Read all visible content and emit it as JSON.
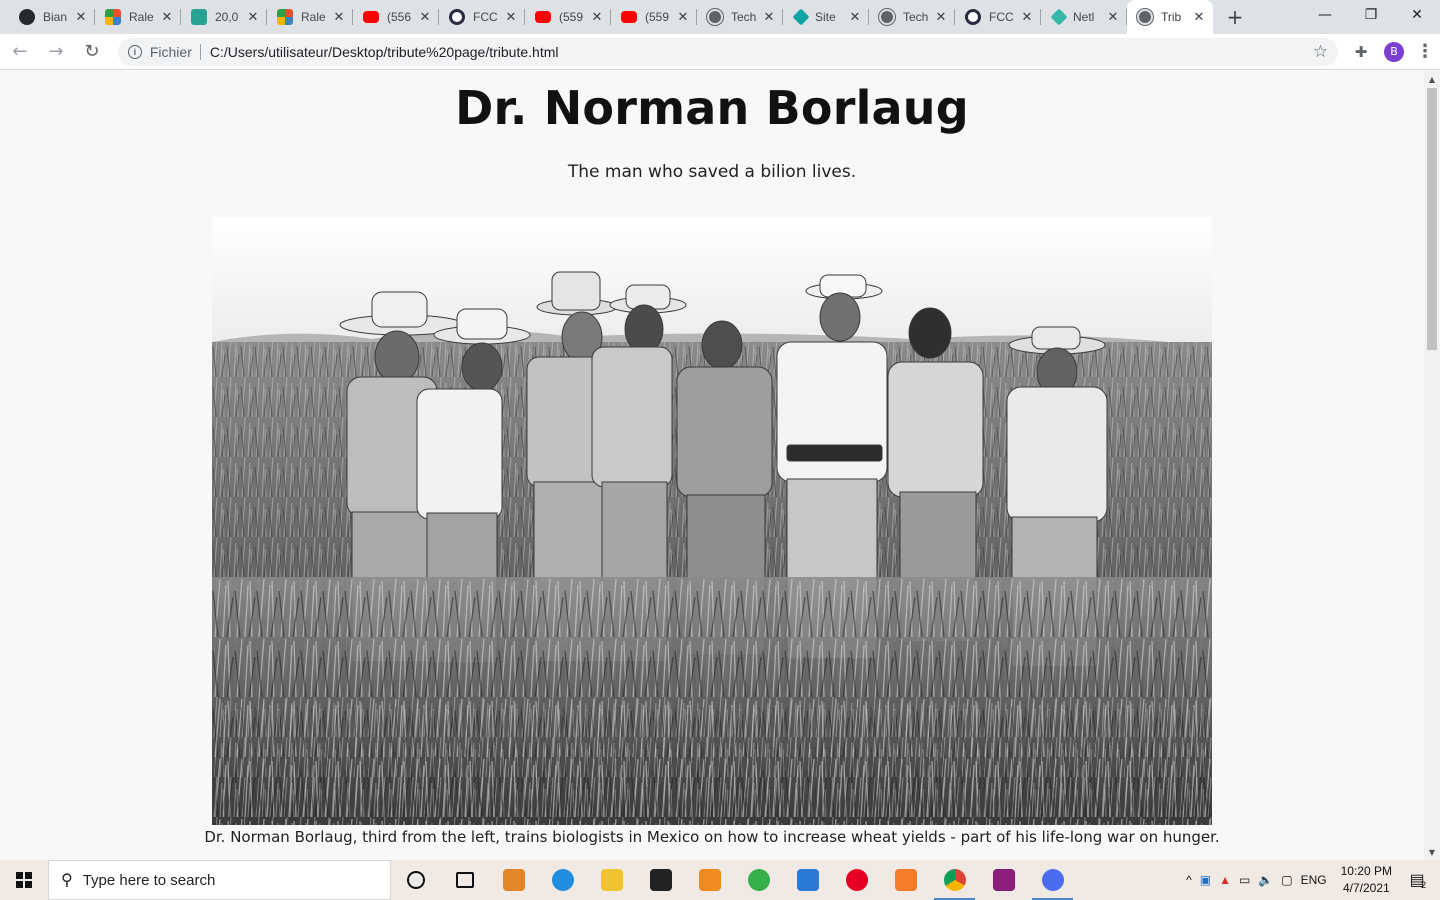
{
  "browser": {
    "tabs": [
      {
        "title": "Bian",
        "icon": "github-icon"
      },
      {
        "title": "Rale",
        "icon": "rale-icon"
      },
      {
        "title": "20,0",
        "icon": "dev-icon"
      },
      {
        "title": "Rale",
        "icon": "rale-icon"
      },
      {
        "title": "(556",
        "icon": "youtube-icon"
      },
      {
        "title": "FCC",
        "icon": "fcc-icon"
      },
      {
        "title": "(559",
        "icon": "youtube-icon"
      },
      {
        "title": "(559",
        "icon": "youtube-icon"
      },
      {
        "title": "Tech",
        "icon": "globe-icon"
      },
      {
        "title": "Site",
        "icon": "site-icon"
      },
      {
        "title": "Tech",
        "icon": "globe-icon"
      },
      {
        "title": "FCC",
        "icon": "fcc-icon"
      },
      {
        "title": "Netl",
        "icon": "netlify-icon"
      },
      {
        "title": "Trib",
        "icon": "globe-icon",
        "active": true
      }
    ],
    "close_glyph": "✕",
    "new_tab_glyph": "+",
    "window_controls": {
      "minimize": "—",
      "restore": "❐",
      "close": "✕"
    },
    "toolbar": {
      "back": "←",
      "forward": "→",
      "reload": "↻",
      "info_glyph": "i",
      "scheme_label": "Fichier",
      "url": "C:/Users/utilisateur/Desktop/tribute%20page/tribute.html",
      "star": "☆",
      "extensions": "✚",
      "avatar_letter": "B",
      "menu": "⋮"
    }
  },
  "page": {
    "title": "Dr. Norman Borlaug",
    "subtitle": "The man who saved a bilion lives.",
    "caption": "Dr. Norman Borlaug, third from the left, trains biologists in Mexico on how to increase wheat yields - part of his life-long war on hunger."
  },
  "taskbar": {
    "search_placeholder": "Type here to search",
    "language": "ENG",
    "time": "10:20 PM",
    "date": "4/7/2021",
    "notification_count": "2",
    "apps": [
      {
        "name": "cortana-icon",
        "color": "#111111"
      },
      {
        "name": "task-view-icon",
        "color": "#111111"
      },
      {
        "name": "media-player-icon",
        "color": "#e3862b"
      },
      {
        "name": "edge-icon",
        "color": "#1f8ee0"
      },
      {
        "name": "file-explorer-icon",
        "color": "#f1c232"
      },
      {
        "name": "store-icon",
        "color": "#222222"
      },
      {
        "name": "sublime-icon",
        "color": "#f08b22"
      },
      {
        "name": "maps-icon",
        "color": "#35b04a"
      },
      {
        "name": "mail-icon",
        "color": "#2b7bd6"
      },
      {
        "name": "pinterest-icon",
        "color": "#e60023"
      },
      {
        "name": "xampp-icon",
        "color": "#f57c2b"
      },
      {
        "name": "chrome-icon",
        "color": "#db4437",
        "active": true
      },
      {
        "name": "winrar-icon",
        "color": "#8b1f7a"
      },
      {
        "name": "paint-icon",
        "color": "#4a6cf0",
        "active": true
      }
    ]
  }
}
